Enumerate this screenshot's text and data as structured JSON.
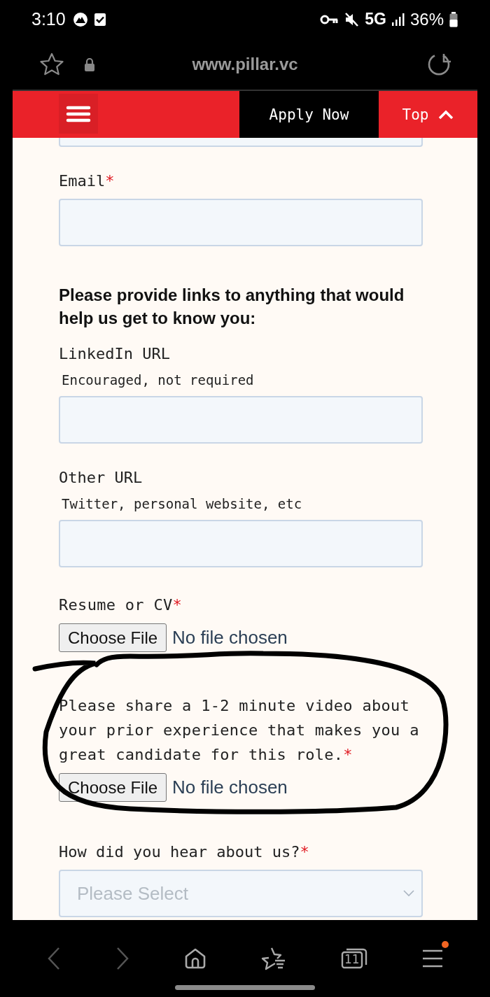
{
  "status_bar": {
    "time": "3:10",
    "network": "5G",
    "battery": "36%"
  },
  "browser": {
    "url": "www.pillar.vc",
    "tab_count": "11",
    "menu_badge": true
  },
  "required_marker": "*",
  "site_header": {
    "apply": "Apply Now",
    "top": "Top"
  },
  "form": [
    {
      "kind": "text",
      "label": "Email",
      "required": true
    },
    {
      "kind": "heading",
      "label": "Please provide links to anything that would help us get to know you:"
    },
    {
      "kind": "text",
      "label": "LinkedIn URL",
      "hint": "Encouraged, not required",
      "required": false
    },
    {
      "kind": "text",
      "label": "Other URL",
      "hint": "Twitter, personal website, etc",
      "required": false
    },
    {
      "kind": "file",
      "label": "Resume or CV",
      "required": true,
      "button": "Choose File",
      "status": "No file chosen"
    },
    {
      "kind": "file",
      "label": "Please share a 1-2 minute video about your prior experience that makes you a great candidate for this role.",
      "required": true,
      "button": "Choose File",
      "status": "No file chosen"
    },
    {
      "kind": "select",
      "label": "How did you hear about us?",
      "required": true,
      "placeholder": "Please Select"
    }
  ]
}
